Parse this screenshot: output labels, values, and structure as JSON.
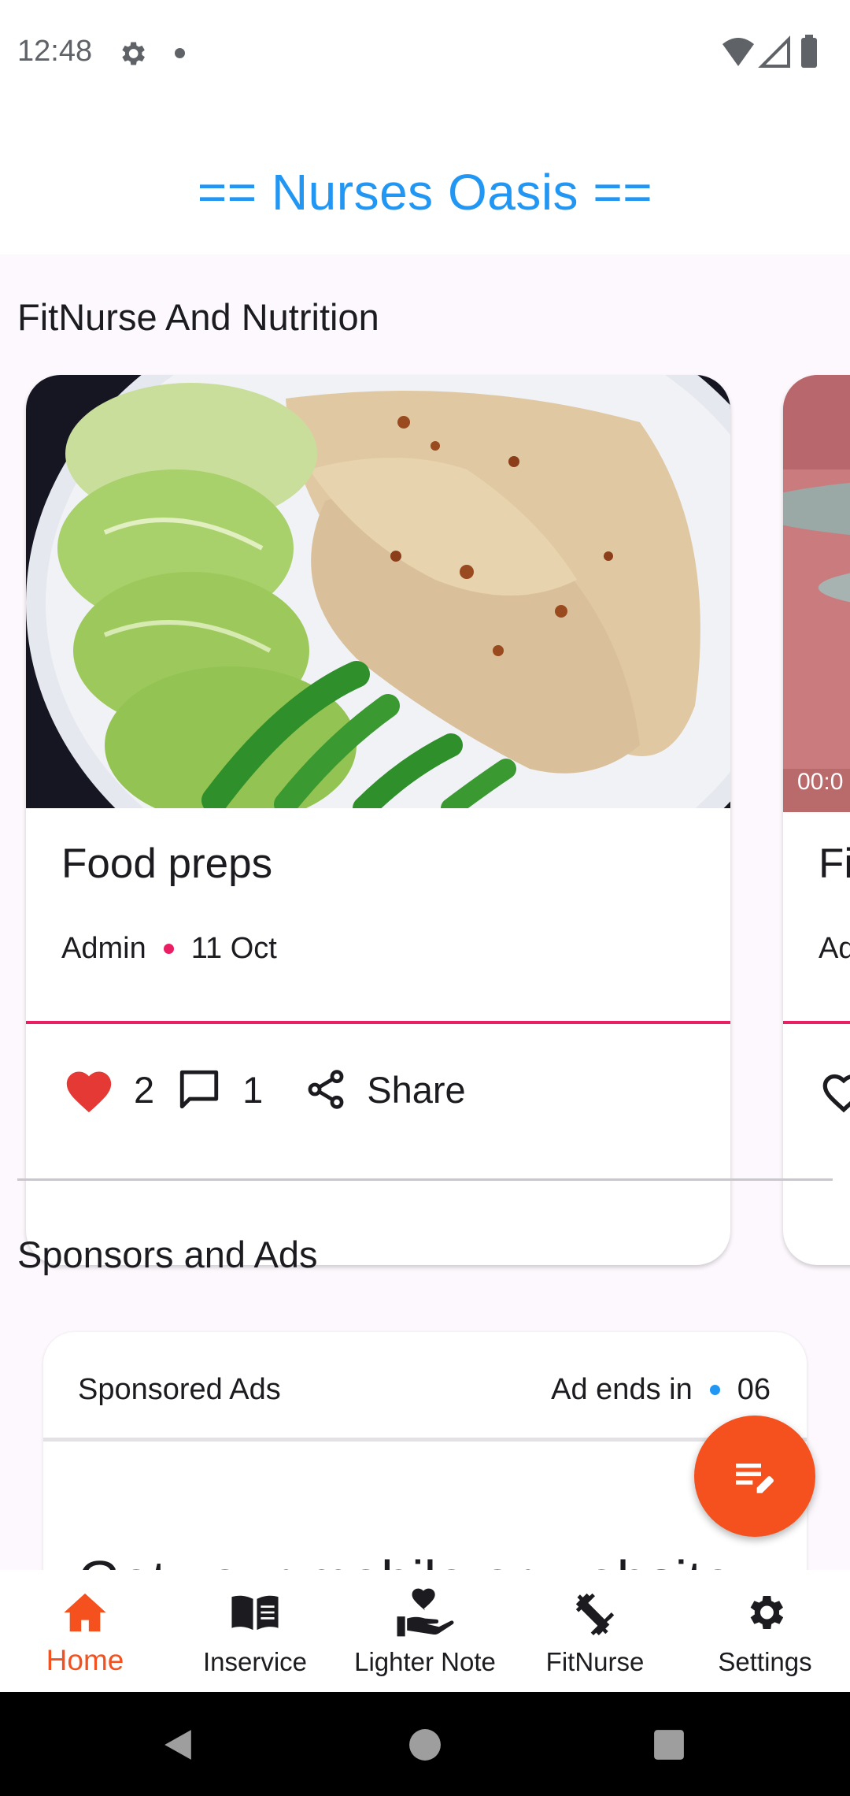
{
  "status_bar": {
    "time": "12:48"
  },
  "header": {
    "title": "== Nurses Oasis =="
  },
  "sections": {
    "fitnurse_title": "FitNurse And Nutrition",
    "sponsors_title": "Sponsors and Ads"
  },
  "posts": [
    {
      "title": "Food preps",
      "author": "Admin",
      "date": "11 Oct",
      "likes": "2",
      "comments": "1",
      "share_label": "Share"
    },
    {
      "title": "Fi",
      "author": "Ad",
      "video_time": "00:0"
    }
  ],
  "ad": {
    "label": "Sponsored Ads",
    "ends_label": "Ad ends in",
    "ends_value": "06",
    "headline": "Get your mobile or website"
  },
  "nav": {
    "items": [
      {
        "label": "Home",
        "icon": "home-icon",
        "active": true
      },
      {
        "label": "Inservice",
        "icon": "book-icon"
      },
      {
        "label": "Lighter Note",
        "icon": "heart-hand-icon"
      },
      {
        "label": "FitNurse",
        "icon": "dumbbell-icon"
      },
      {
        "label": "Settings",
        "icon": "gear-icon"
      }
    ]
  },
  "colors": {
    "accent": "#f4511e",
    "title": "#2196f3",
    "highlight": "#e91e63"
  }
}
